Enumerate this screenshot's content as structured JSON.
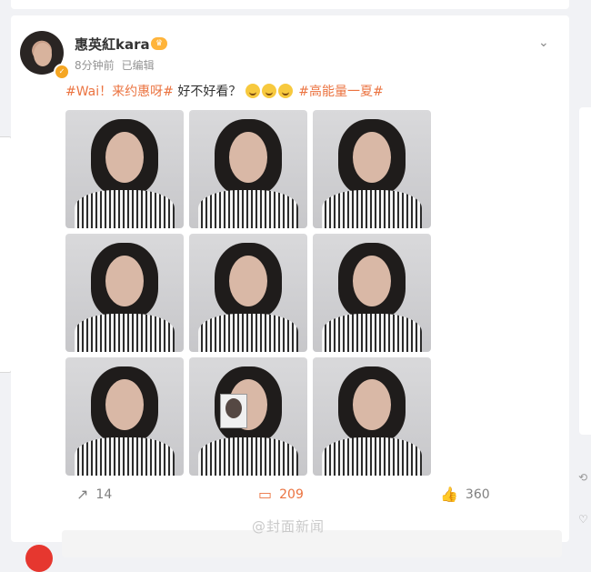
{
  "post": {
    "username": "惠英紅kara",
    "time": "8分钟前",
    "edited": "已编辑",
    "text_hashtag1": "#Wai！来约惠呀#",
    "text_plain": " 好不好看？",
    "text_hashtag2": "#高能量一夏#",
    "emoji_count": 3
  },
  "photos": [
    {
      "label": "photo-1"
    },
    {
      "label": "photo-2"
    },
    {
      "label": "photo-3"
    },
    {
      "label": "photo-4"
    },
    {
      "label": "photo-5"
    },
    {
      "label": "photo-6"
    },
    {
      "label": "photo-7"
    },
    {
      "label": "photo-8"
    },
    {
      "label": "photo-9"
    }
  ],
  "actions": {
    "repost_count": "14",
    "comment_count": "209",
    "like_count": "360"
  },
  "watermark": "@封面新闻",
  "icons": {
    "more": "chevron-down-icon",
    "repost": "repost-icon",
    "comment": "comment-icon",
    "like": "like-icon"
  },
  "colors": {
    "hashtag": "#eb7340",
    "comment_active": "#eb7340",
    "badge": "#f5a623"
  }
}
